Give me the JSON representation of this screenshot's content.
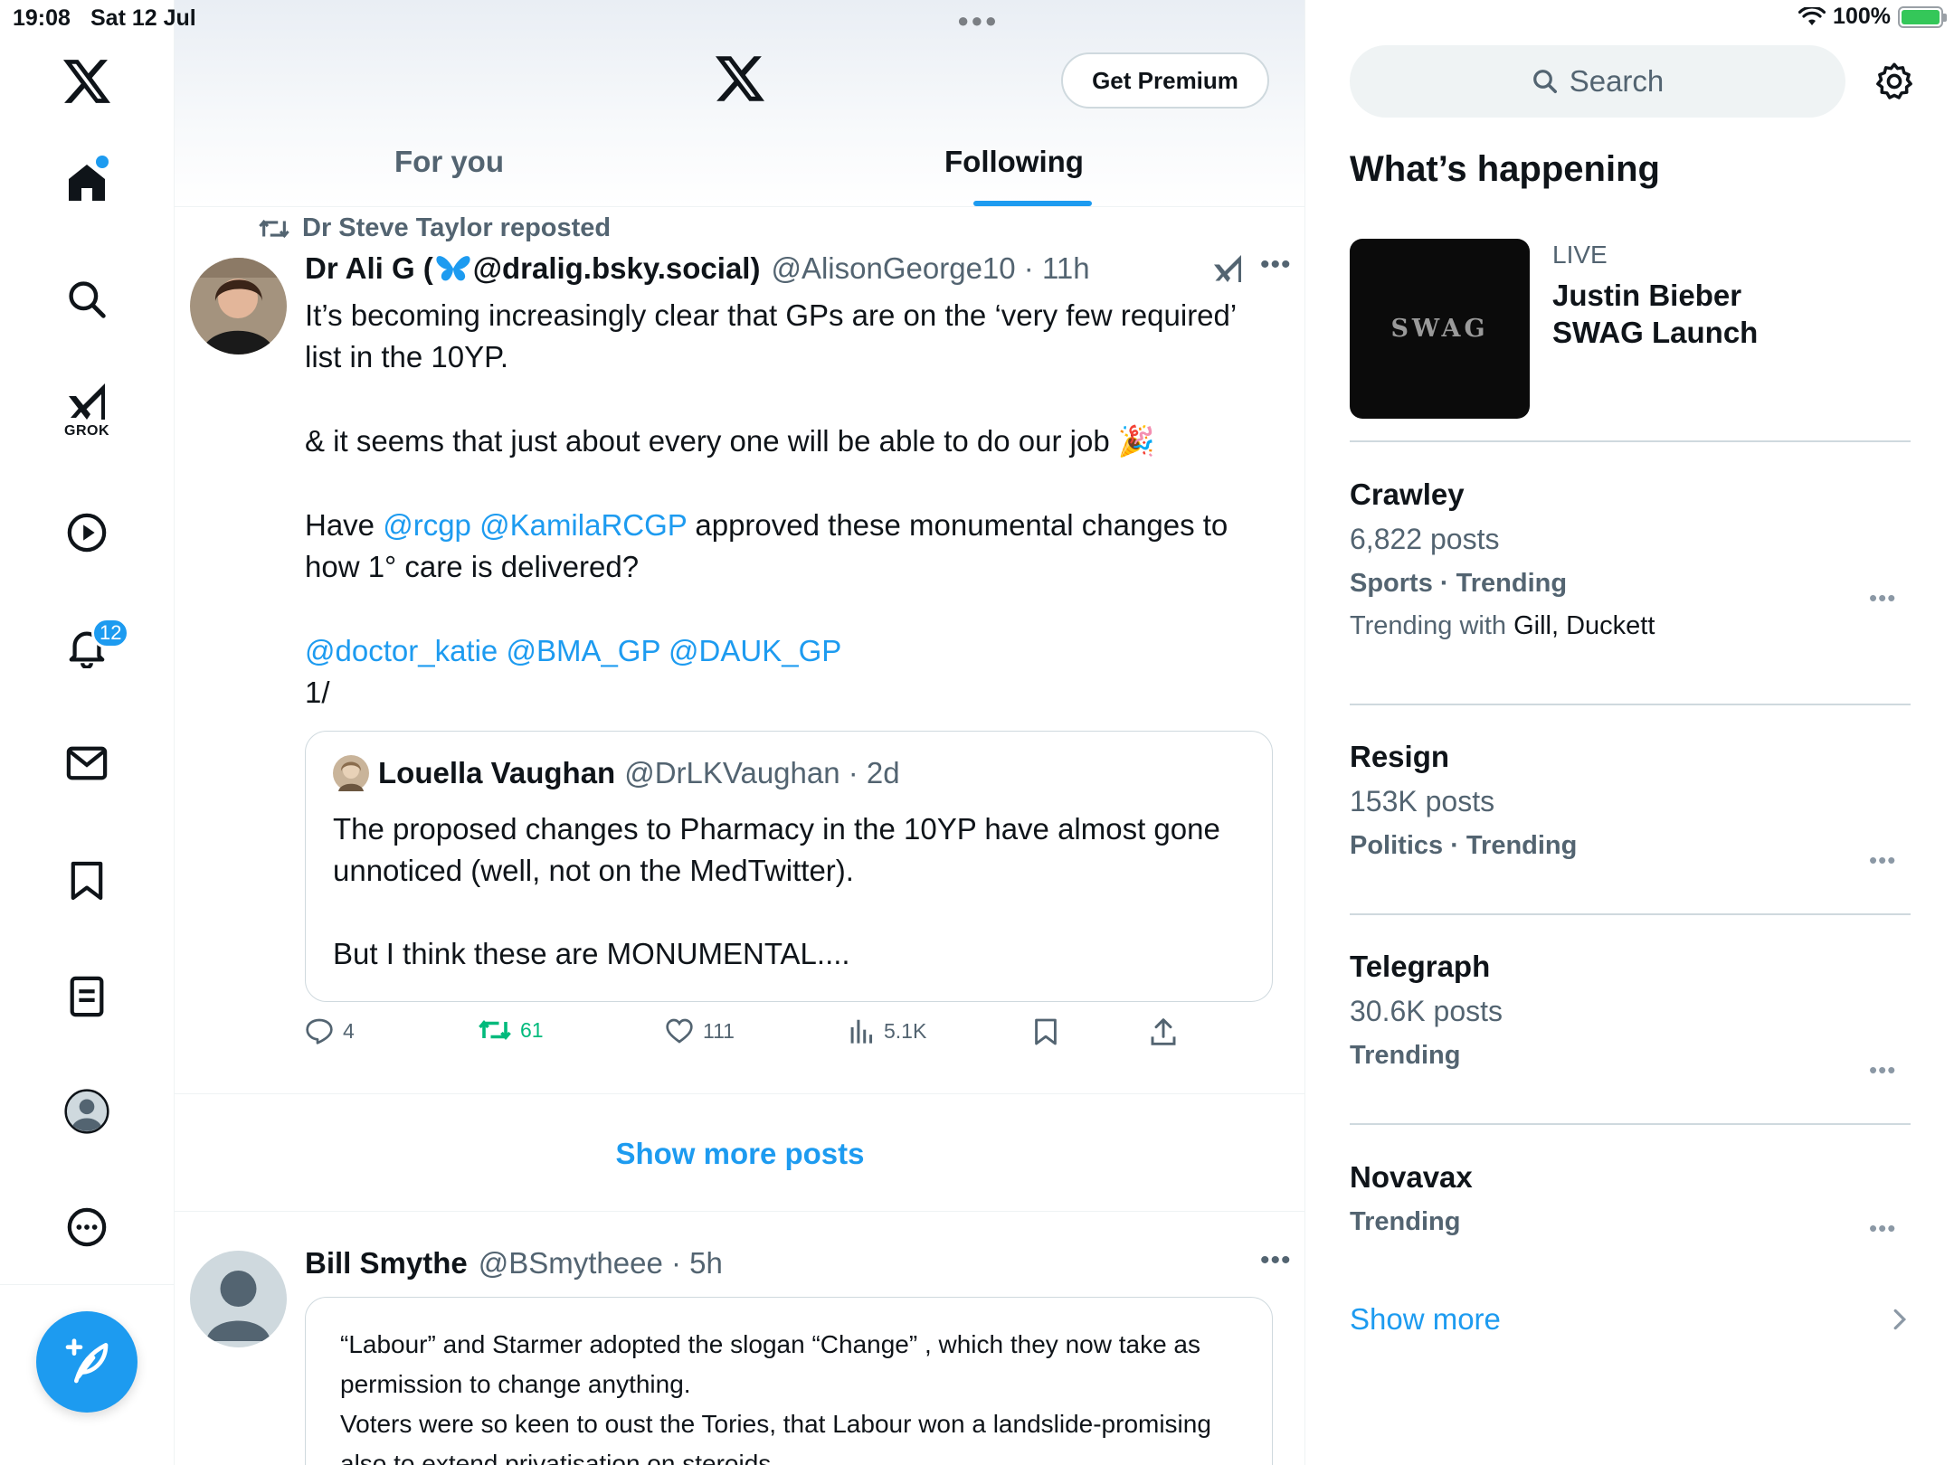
{
  "status_bar": {
    "time": "19:08",
    "date": "Sat 12 Jul",
    "battery": "100%",
    "battery_color": "#34c759"
  },
  "nav": {
    "notifications_badge": "12",
    "grok_label": "GROK",
    "items": [
      "x-logo",
      "home-icon",
      "search-icon",
      "grok-icon",
      "video-icon",
      "bell-icon",
      "mail-icon",
      "bookmark-icon",
      "lists-icon",
      "profile-icon",
      "more-icon"
    ],
    "accent": "#1d9bf0"
  },
  "header": {
    "get_premium": "Get Premium",
    "tabs": [
      {
        "label": "For you",
        "active": false
      },
      {
        "label": "Following",
        "active": true
      }
    ]
  },
  "post1": {
    "repost_by": "Dr Steve Taylor reposted",
    "author_name_pre": "Dr Ali G (",
    "author_name_post": " @dralig.bsky.social)",
    "handle": "@AlisonGeorge10 · 11h",
    "text1_a": "It’s becoming increasingly clear that GPs are on the ‘very few required’",
    "text1_b": "list in the 10YP.",
    "text2": "& it seems that just about every one will be able to do our job 🎉",
    "text3_pre": "Have ",
    "text3_mentions": "@rcgp @KamilaRCGP",
    "text3_post": " approved these monumental changes to",
    "text3_b": "how 1° care is delivered?",
    "text4_mentions": "@doctor_katie @BMA_GP @DAUK_GP",
    "text5": "1/",
    "quote": {
      "name": "Louella Vaughan",
      "handle": "@DrLKVaughan · 2d",
      "text_a": "The proposed changes to Pharmacy in the 10YP have almost gone",
      "text_b": "unnoticed (well, not on the MedTwitter).",
      "text_c": "But I think these are MONUMENTAL...."
    },
    "actions": {
      "replies": "4",
      "reposts": "61",
      "likes": "111",
      "views": "5.1K"
    }
  },
  "show_more_posts": "Show more posts",
  "post2": {
    "name": "Bill Smythe",
    "handle": "@BSmytheee · 5h",
    "text_a": "“Labour” and Starmer adopted the slogan “Change” , which they now take as",
    "text_b": "permission to change anything.",
    "text_c": "Voters were so keen to oust the Tories, that Labour won a landslide-promising",
    "text_d": "also to extend privatisation on steroids"
  },
  "sidebar": {
    "search_placeholder": "Search",
    "whats_happening": "What’s happening",
    "live": {
      "label": "LIVE",
      "image_text": "SWAG",
      "title": "Justin Bieber SWAG Launch"
    },
    "trends": [
      {
        "title": "Crawley",
        "posts": "6,822 posts",
        "category": "Sports · Trending",
        "with_label": "Trending with ",
        "with_names": "Gill, Duckett"
      },
      {
        "title": "Resign",
        "posts": "153K posts",
        "category": "Politics · Trending"
      },
      {
        "title": "Telegraph",
        "posts": "30.6K posts",
        "category": "Trending"
      },
      {
        "title": "Novavax",
        "category": "Trending"
      }
    ],
    "show_more": "Show more"
  }
}
